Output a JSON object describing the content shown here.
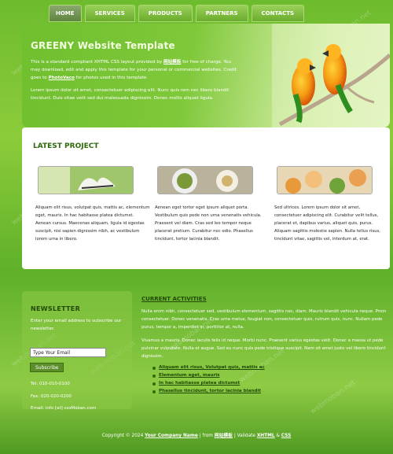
{
  "nav": {
    "items": [
      {
        "label": "HOME",
        "active": true
      },
      {
        "label": "SERVICES",
        "active": false
      },
      {
        "label": "PRODUCTS",
        "active": false
      },
      {
        "label": "PARTNERS",
        "active": false
      },
      {
        "label": "CONTACTS",
        "active": false
      }
    ]
  },
  "hero": {
    "title": "GREENY Website Template",
    "p1_a": "This is a standard compliant XHTML CSS layout provided by ",
    "p1_link": "网站模板",
    "p1_b": " for free of charge. You may download, edit and apply this template for your personal or commercial websites. Credit goes to ",
    "p1_link2": "PhotoVaco",
    "p1_c": " for photos used in this template.",
    "p2": "Lorem ipsum dolor sit amet, consectetuer adipiscing elit. Nunc quis rem nec libero blandit tincidunt. Duis vitae velit sed dui malesuada dignissim. Donec mollis aliquet ligula."
  },
  "latest": {
    "title": "LATEST PROJECT",
    "columns": [
      {
        "text": "Aliquam elit risus, volutpat quis, mattis ac, elementum eget, mauris. In hac habitasse platea dictumst. Aenean cursus. Maecenas aliquam, ligula id egestas suscipit, nisi sapien dignissim nibh, ac vestibulum lorem urna in libero."
      },
      {
        "text": "Aenean eget tortor eget ipsum aliquet porta. Vestibulum quis pede non urna venenatis vehicula. Praesent vel diam. Cras sed leo tempor neque placerat pretium. Curabitur nec odio. Phasellus tincidunt, tortor lacinia blandit."
      },
      {
        "text": "Sed ultrices. Lorem ipsum dolor sit amet, consectetuer adipiscing elit. Curabitur velit tellus, placerat et, dapibus varius, aliquet quis, purus. Aliquam sagittis molestie sapien. Nulla tellus risus, tincidunt vitae, sagittis vel, interdum at, erat."
      }
    ]
  },
  "newsletter": {
    "title": "NEWSLETTER",
    "text": "Enter your email address to subscribe our newsletter.",
    "input_value": "Type Your Email",
    "button": "Subscribe",
    "tel": "Tel: 010-010-0100",
    "fax": "Fax: 020-020-0200",
    "email": "Email: info [at] cssMoban.com"
  },
  "activities": {
    "title": "CURRENT ACTIVITIES",
    "p1": "Nulla enim nibh, consectetuer sed, vestibulum elementum, sagittis nec, diam. Mauris blandit vehicula neque. Proin consectetuer. Donec venenatis. Cras urna metus, feugiat non, consectetuer quis, rutrum quis, nunc. Nullam pede purus, tempor a, imperdiet in, porttitor at, nulla.",
    "p2": "Vivamus a mauris. Donec iaculis felis id neque. Morbi nunc. Praesent varius egestas velit. Donec a massa ut pede pulvinar vulputate. Nulla et augue. Sed eu nunc quis pede tristique suscipit. Nam sit amet justo vel libero tincidunt dignissim.",
    "list": [
      "Aliquam elit risus, Volutpat quis, mattis ac",
      "Elementum eget, mauris",
      "In hac habitasse platea dictumst",
      "Phasellus tincidunt, tortor lacinia blandit"
    ]
  },
  "footer": {
    "a": "Copyright © 2024 ",
    "company": "Your Company Name",
    "b": " | from ",
    "from": "网站模板",
    "c": " | Validate ",
    "xhtml": "XHTML",
    "amp": " & ",
    "css": "CSS"
  },
  "watermark": "webmoban.net"
}
